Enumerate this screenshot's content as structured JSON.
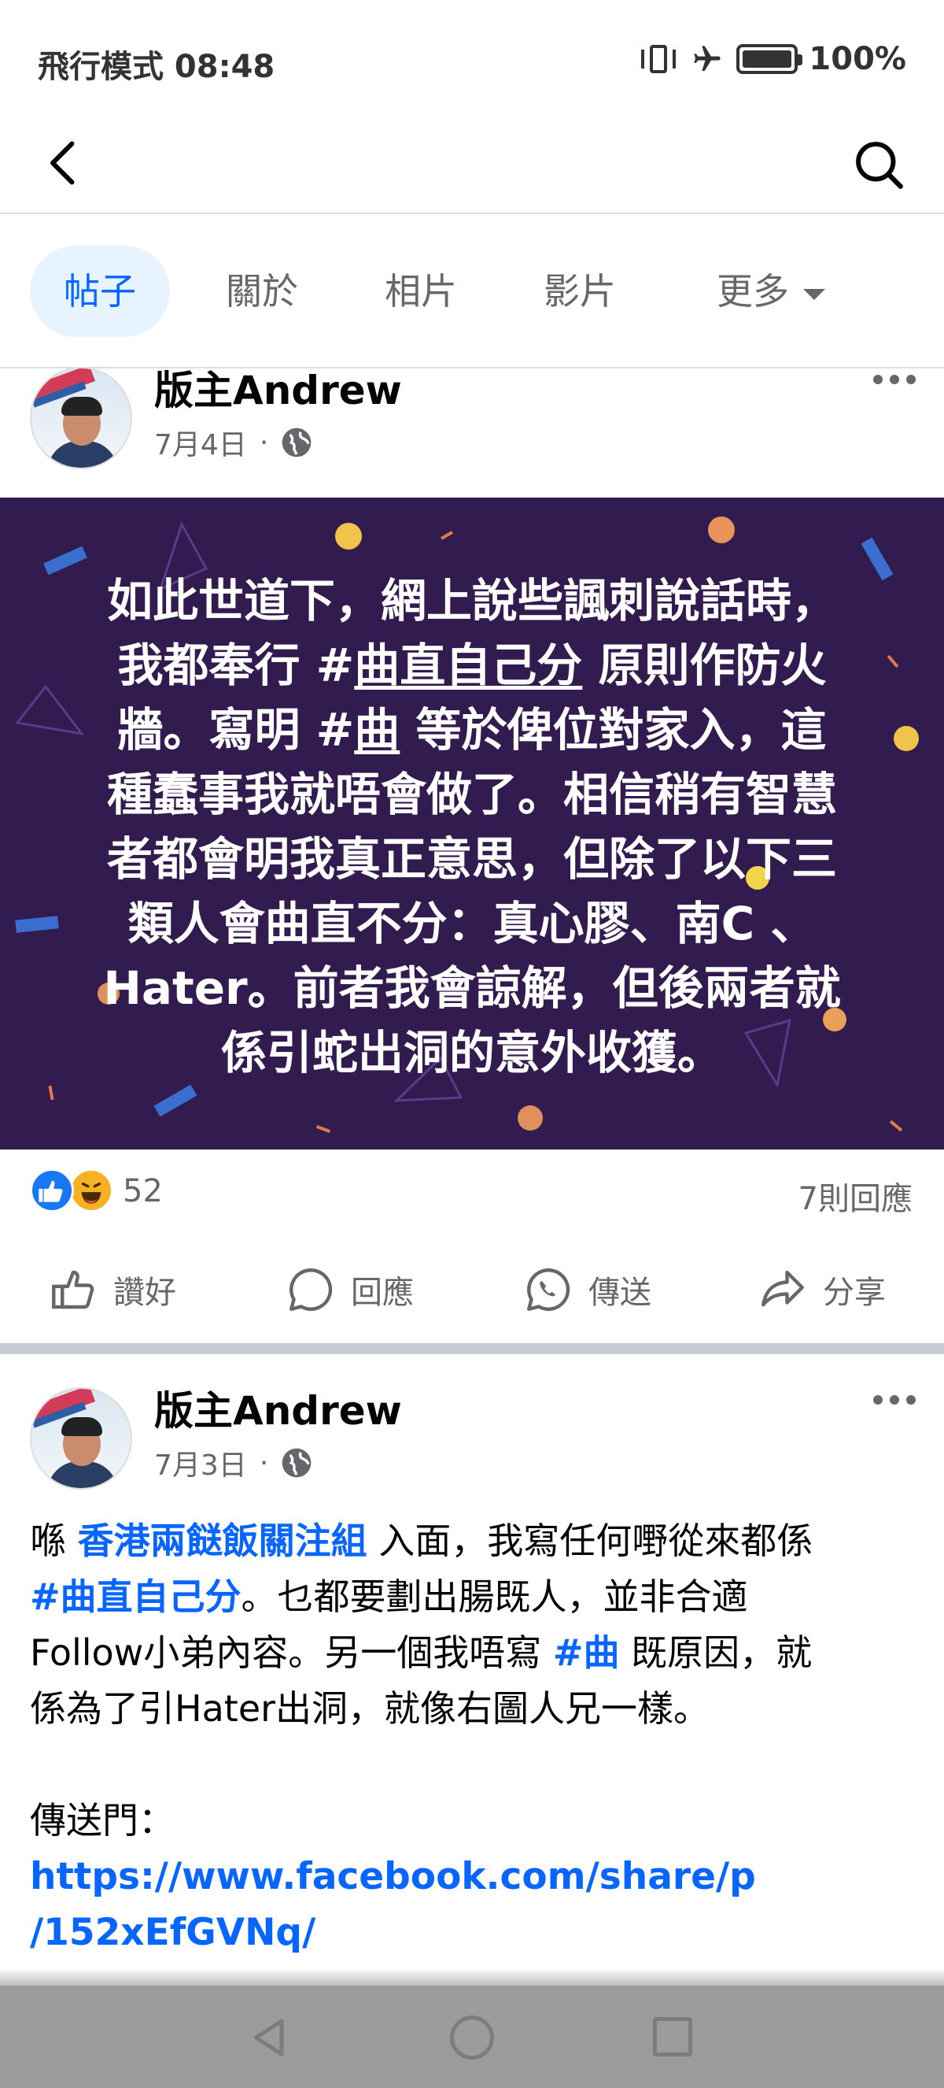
{
  "status_bar": {
    "left": "飛行模式 08:48",
    "battery": "100%"
  },
  "header": {
    "back_icon": "back-arrow-icon",
    "search_icon": "search-icon"
  },
  "tabs": [
    {
      "label": "帖子",
      "active": true
    },
    {
      "label": "關於",
      "active": false
    },
    {
      "label": "相片",
      "active": false
    },
    {
      "label": "影片",
      "active": false
    },
    {
      "label": "更多",
      "active": false
    }
  ],
  "post1": {
    "author": "版主Andrew",
    "date": "7月4日",
    "separator": "·",
    "image_text": {
      "line1": "如此世道下，網上說些諷刺說話時，",
      "line2_a": "我都奉行 #",
      "line2_u": "曲直自己分",
      "line2_b": " 原則作防火",
      "line3_a": "牆。寫明 #",
      "line3_u": "曲",
      "line3_b": " 等於俾位對家入，這",
      "line4": "種蠢事我就唔會做了。相信稍有智慧",
      "line5": "者都會明我真正意思，但除了以下三",
      "line6": "類人會曲直不分：真心膠、南C 、",
      "line7": "Hater。前者我會諒解，但後兩者就",
      "line8": "係引蛇出洞的意外收獲。"
    },
    "reaction_count": "52",
    "comment_count": "7則回應",
    "actions": {
      "like": "讚好",
      "comment": "回應",
      "send": "傳送",
      "share": "分享"
    }
  },
  "post2": {
    "author": "版主Andrew",
    "date": "7月3日",
    "separator": "·",
    "body": {
      "t1": "喺 ",
      "group_link": "香港兩餸飯關注組",
      "t2": " 入面，我寫任何嘢從來都係",
      "tag1": "#曲直自己分",
      "t3": "。乜都要劃出腸既人，並非合適",
      "t4": "Follow小弟內容。另一個我唔寫 ",
      "tag2": "#曲",
      "t5": " 既原因，就",
      "t6": "係為了引Hater出洞，就像右圖人兄一樣。",
      "portal": "傳送門：",
      "url1": "https://www.facebook.com/share/p",
      "url2": "/152xEfGVNq/"
    }
  },
  "colors": {
    "accent": "#0866ff",
    "card_bg": "#321c4f",
    "like": "#1877f2"
  }
}
